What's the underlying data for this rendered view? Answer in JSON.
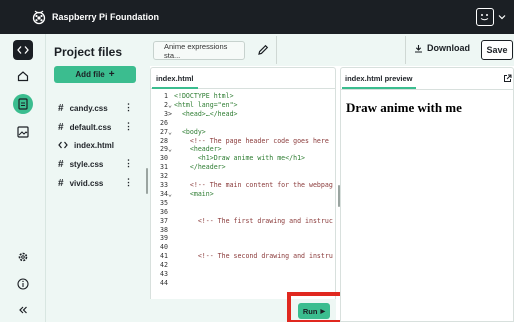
{
  "topbar": {
    "org_name": "Raspberry Pi Foundation"
  },
  "rail": {
    "icons": [
      "code-icon",
      "home-icon",
      "file-icon",
      "image-icon",
      "settings-icon",
      "info-icon",
      "collapse-icon"
    ]
  },
  "files_panel": {
    "title": "Project files",
    "add_file_label": "Add file",
    "add_file_icon": "+",
    "files": [
      {
        "name": "candy.css",
        "type": "css",
        "kebab": "⋮"
      },
      {
        "name": "default.css",
        "type": "css",
        "kebab": "⋮"
      },
      {
        "name": "index.html",
        "type": "html",
        "kebab": ""
      },
      {
        "name": "style.css",
        "type": "css",
        "kebab": "⋮"
      },
      {
        "name": "vivid.css",
        "type": "css",
        "kebab": "⋮"
      }
    ]
  },
  "header": {
    "project_name": "Anime expressions sta...",
    "download_label": "Download",
    "save_label": "Save"
  },
  "editor": {
    "tab_label": "index.html",
    "lines": [
      {
        "n": "1",
        "fold": "",
        "text": "<!DOCTYPE html>"
      },
      {
        "n": "2",
        "fold": "⌄",
        "text": "<html lang=\"en\">"
      },
      {
        "n": "3",
        "fold": ">",
        "text": "  <head>…</head>"
      },
      {
        "n": "26",
        "fold": "",
        "text": ""
      },
      {
        "n": "27",
        "fold": "⌄",
        "text": "  <body>"
      },
      {
        "n": "28",
        "fold": "",
        "text": "    <!-- The page header code goes here"
      },
      {
        "n": "29",
        "fold": "⌄",
        "text": "    <header>"
      },
      {
        "n": "30",
        "fold": "",
        "text": "      <h1>Draw anime with me</h1>"
      },
      {
        "n": "31",
        "fold": "",
        "text": "    </header>"
      },
      {
        "n": "32",
        "fold": "",
        "text": ""
      },
      {
        "n": "33",
        "fold": "",
        "text": "    <!-- The main content for the webpag"
      },
      {
        "n": "34",
        "fold": "⌄",
        "text": "    <main>"
      },
      {
        "n": "35",
        "fold": "",
        "text": ""
      },
      {
        "n": "36",
        "fold": "",
        "text": ""
      },
      {
        "n": "37",
        "fold": "",
        "text": "      <!-- The first drawing and instruc"
      },
      {
        "n": "38",
        "fold": "",
        "text": ""
      },
      {
        "n": "39",
        "fold": "",
        "text": ""
      },
      {
        "n": "40",
        "fold": "",
        "text": ""
      },
      {
        "n": "41",
        "fold": "",
        "text": "      <!-- The second drawing and instru"
      },
      {
        "n": "42",
        "fold": "",
        "text": ""
      },
      {
        "n": "43",
        "fold": "",
        "text": ""
      },
      {
        "n": "44",
        "fold": "",
        "text": ""
      }
    ]
  },
  "run": {
    "label": "Run",
    "icon": "▶"
  },
  "preview": {
    "tab_label": "index.html preview",
    "heading": "Draw anime with me"
  },
  "colors": {
    "accent": "#3bbd8f",
    "topbar": "#1b1f24",
    "highlight": "#e0281f",
    "panel_bg": "#eef7f4"
  }
}
